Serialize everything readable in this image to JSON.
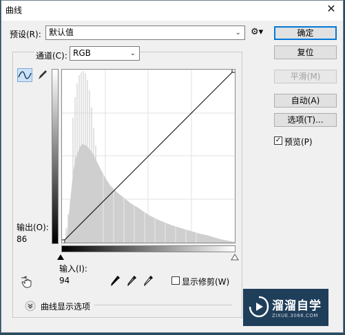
{
  "window": {
    "title": "曲线",
    "close_label": "✕"
  },
  "preset": {
    "label": "预设(R):",
    "value": "默认值"
  },
  "channel": {
    "label": "通道(C):",
    "value": "RGB"
  },
  "buttons": {
    "ok": "确定",
    "reset": "复位",
    "smooth": "平滑(M)",
    "auto": "自动(A)",
    "options": "选项(T)..."
  },
  "preview": {
    "label": "预览(P)",
    "checked": true
  },
  "output": {
    "label": "输出(O):",
    "value": "86"
  },
  "input": {
    "label": "输入(I):",
    "value": "94"
  },
  "show_clipping": {
    "label": "显示修剪(W)",
    "checked": false
  },
  "curve_display_options": {
    "label": "曲线显示选项"
  },
  "watermark": {
    "brand": "溜溜自学",
    "url": "ZIXUE.3066.COM"
  },
  "icons": {
    "settings": "gear-icon",
    "curve_tool": "curve-tool-icon",
    "pencil_tool": "pencil-tool-icon",
    "hand_adjust": "targeted-adjustment-icon",
    "eyedropper_black": "black-eyedropper-icon",
    "eyedropper_gray": "gray-eyedropper-icon",
    "eyedropper_white": "white-eyedropper-icon"
  }
}
